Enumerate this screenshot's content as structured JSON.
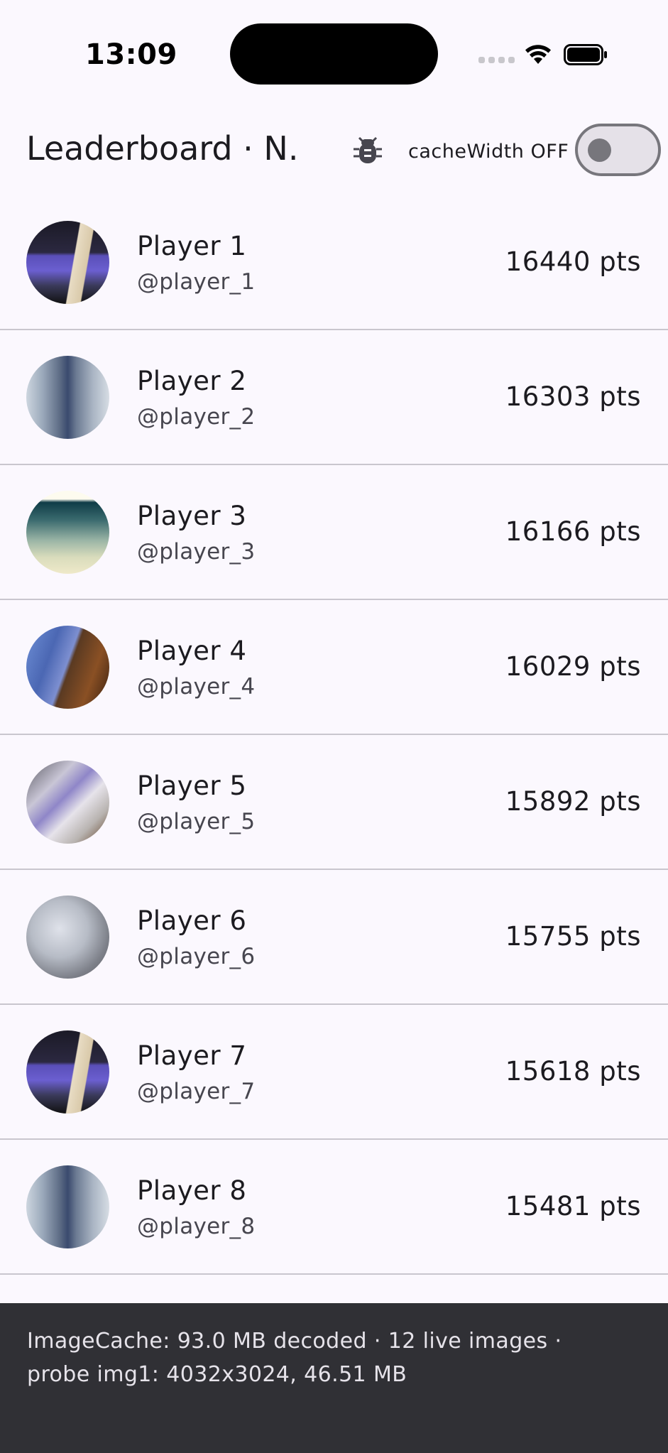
{
  "status_bar": {
    "time": "13:09"
  },
  "app_bar": {
    "title": "Leaderboard · N...",
    "debug_icon": "bug-icon",
    "cache_toggle_label": "cacheWidth OFF",
    "cache_toggle_on": false
  },
  "players": [
    {
      "name": "Player 1",
      "handle": "@player_1",
      "points": "16440 pts"
    },
    {
      "name": "Player 2",
      "handle": "@player_2",
      "points": "16303 pts"
    },
    {
      "name": "Player 3",
      "handle": "@player_3",
      "points": "16166 pts"
    },
    {
      "name": "Player 4",
      "handle": "@player_4",
      "points": "16029 pts"
    },
    {
      "name": "Player 5",
      "handle": "@player_5",
      "points": "15892 pts"
    },
    {
      "name": "Player 6",
      "handle": "@player_6",
      "points": "15755 pts"
    },
    {
      "name": "Player 7",
      "handle": "@player_7",
      "points": "15618 pts"
    },
    {
      "name": "Player 8",
      "handle": "@player_8",
      "points": "15481 pts"
    }
  ],
  "footer": {
    "line1": "ImageCache: 93.0 MB decoded · 12 live images ·",
    "line2": "probe img1: 4032x3024, 46.51 MB"
  },
  "colors": {
    "background": "#fbf8fe",
    "footer_background": "#303035",
    "divider": "#c9c6ce",
    "toggle_outline": "#77767c"
  }
}
